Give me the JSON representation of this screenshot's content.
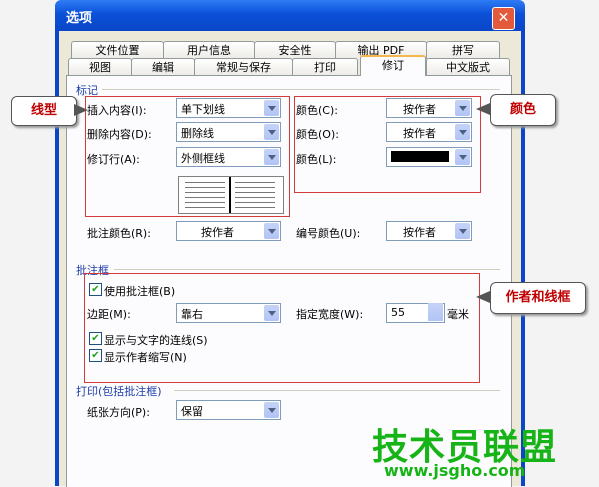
{
  "window": {
    "title": "选项",
    "close": "✕"
  },
  "tabs_row1": [
    "文件位置",
    "用户信息",
    "安全性",
    "输出 PDF",
    "拼写"
  ],
  "tabs_row2": [
    "视图",
    "编辑",
    "常规与保存",
    "打印",
    "修订",
    "中文版式"
  ],
  "active_tab": "修订",
  "markup": {
    "group": "标记",
    "insert_label": "插入内容(I):",
    "insert_value": "单下划线",
    "delete_label": "删除内容(D):",
    "delete_value": "删除线",
    "revline_label": "修订行(A):",
    "revline_value": "外侧框线",
    "color1_label": "颜色(C):",
    "color1_value": "按作者",
    "color2_label": "颜色(O):",
    "color2_value": "按作者",
    "color3_label": "颜色(L):",
    "color3_swatch": "#000000",
    "comment_color_label": "批注颜色(R):",
    "comment_color_value": "按作者",
    "number_color_label": "编号颜色(U):",
    "number_color_value": "按作者"
  },
  "balloons": {
    "group": "批注框",
    "use_label": "使用批注框(B)",
    "use_checked": true,
    "margin_label": "边距(M):",
    "margin_value": "靠右",
    "width_label": "指定宽度(W):",
    "width_value": "55",
    "width_unit": "毫米",
    "lines_label": "显示与文字的连线(S)",
    "lines_checked": true,
    "author_label": "显示作者缩写(N)",
    "author_checked": true
  },
  "print": {
    "group": "打印(包括批注框)",
    "orient_label": "纸张方向(P):",
    "orient_value": "保留"
  },
  "callouts": {
    "linetype": "线型",
    "color": "颜色",
    "author": "作者和线框"
  },
  "watermark": {
    "title": "技术员联盟",
    "url": "www.jsgho.com"
  },
  "colors": {
    "accent": "#0a46c7",
    "group_text": "#1d3ca8",
    "callout_text": "#c00000",
    "redbox": "#d23b3b",
    "watermark": "#17b417"
  }
}
